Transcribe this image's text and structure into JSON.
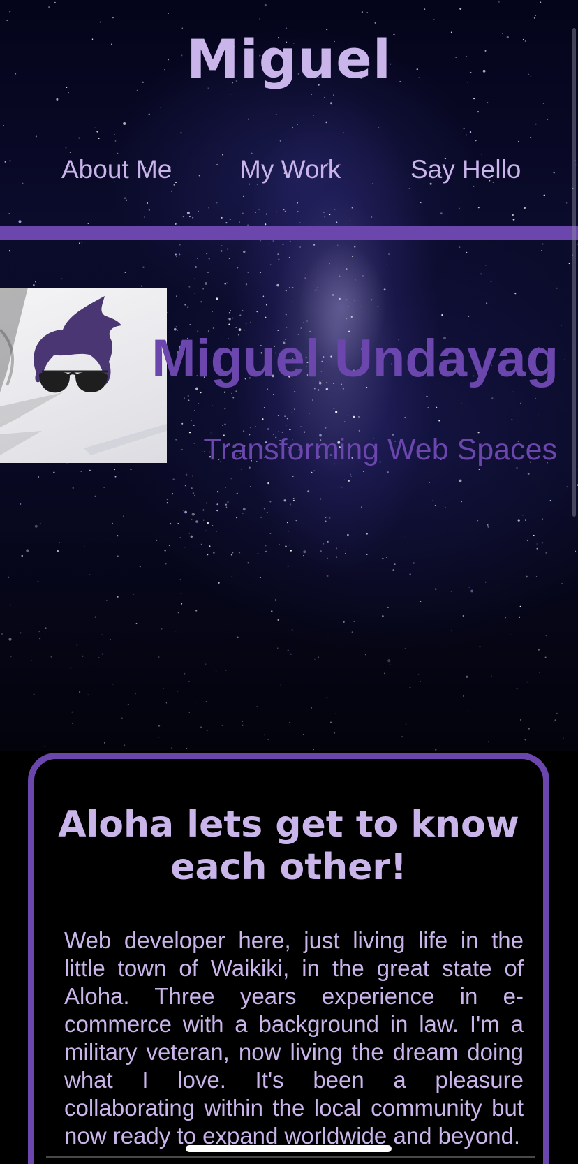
{
  "header": {
    "site_title": "Miguel",
    "nav": [
      {
        "label": "About Me"
      },
      {
        "label": "My Work"
      },
      {
        "label": "Say Hello"
      }
    ]
  },
  "hero": {
    "name": "Miguel Undayag",
    "tagline": "Transforming Web Spaces",
    "avatar_icon": "cartoon-avatar-with-sunglasses"
  },
  "about": {
    "title": "Aloha lets get to know each other!",
    "body": "Web developer here, just living life in the little town of Waikiki, in the great state of Aloha. Three years experience in e-commerce with a background in law. I'm a military veteran, now living the dream doing what I love. It's been a pleasure collaborating within the local community but now ready to expand worldwide and beyond."
  },
  "colors": {
    "accent": "#6a46ad",
    "text_light": "#c9b5ea",
    "background": "#000000"
  }
}
